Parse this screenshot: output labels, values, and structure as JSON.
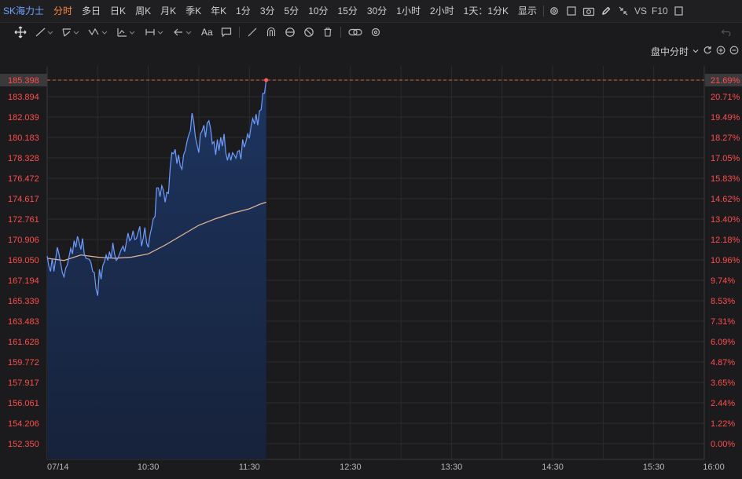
{
  "toolbar": {
    "symbol": "SK海力士",
    "tabs": [
      "分时",
      "多日",
      "日K",
      "周K",
      "月K",
      "季K",
      "年K",
      "1分",
      "3分",
      "5分",
      "10分",
      "15分",
      "30分",
      "1小时",
      "2小时",
      "1天：1分K",
      "显示"
    ],
    "active_tab": "分时",
    "right_labels": {
      "vs": "VS",
      "f10": "F10"
    }
  },
  "drawing_tools": {
    "text_tool": "Aa"
  },
  "mode": {
    "label": "盘中分时"
  },
  "colors": {
    "background": "#1b1b1d",
    "line": "#6f9cff",
    "avg": "#e8b89a",
    "fill_top": "#1d3560",
    "fill_bottom": "#17223a",
    "up_text": "#ff4d4d",
    "grid": "#2c2c2f",
    "ref_line": "#e0603a"
  },
  "chart_data": {
    "type": "line",
    "base_price": 152.35,
    "current_price": 185.398,
    "current_pct": "21.69%",
    "y_labels": [
      "185.398",
      "183.894",
      "182.039",
      "180.183",
      "178.328",
      "176.472",
      "174.617",
      "172.761",
      "170.906",
      "169.050",
      "167.194",
      "165.339",
      "163.483",
      "161.628",
      "159.772",
      "157.917",
      "156.061",
      "154.206",
      "152.350"
    ],
    "pct_labels": [
      "21.69%",
      "20.71%",
      "19.49%",
      "18.27%",
      "17.05%",
      "15.83%",
      "14.62%",
      "13.40%",
      "12.18%",
      "10.96%",
      "9.74%",
      "8.53%",
      "7.31%",
      "6.09%",
      "4.87%",
      "3.65%",
      "2.44%",
      "1.22%",
      "0.00%"
    ],
    "x_labels": [
      "07/14",
      "10:30",
      "11:30",
      "12:30",
      "13:30",
      "14:30",
      "15:30",
      "16:00"
    ],
    "x_label_minutes": [
      0,
      60,
      120,
      180,
      240,
      300,
      360,
      390
    ],
    "price_series": [
      [
        0,
        169.4
      ],
      [
        1,
        168.5
      ],
      [
        2,
        168.0
      ],
      [
        3,
        169.2
      ],
      [
        4,
        168.0
      ],
      [
        6,
        170.2
      ],
      [
        7,
        169.6
      ],
      [
        9,
        167.9
      ],
      [
        10,
        167.5
      ],
      [
        11,
        168.3
      ],
      [
        12,
        168.6
      ],
      [
        14,
        170.1
      ],
      [
        15,
        169.6
      ],
      [
        16,
        170.8
      ],
      [
        17,
        170.2
      ],
      [
        18,
        171.2
      ],
      [
        20,
        170.0
      ],
      [
        21,
        171.0
      ],
      [
        22,
        169.6
      ],
      [
        23,
        169.2
      ],
      [
        25,
        169.1
      ],
      [
        26,
        168.8
      ],
      [
        27,
        168.0
      ],
      [
        28,
        167.9
      ],
      [
        29,
        166.4
      ],
      [
        30,
        165.8
      ],
      [
        31,
        168.2
      ],
      [
        32,
        167.3
      ],
      [
        33,
        168.5
      ],
      [
        34,
        168.9
      ],
      [
        35,
        169.5
      ],
      [
        36,
        169.0
      ],
      [
        37,
        169.8
      ],
      [
        38,
        169.2
      ],
      [
        39,
        170.6
      ],
      [
        40,
        169.6
      ],
      [
        41,
        169.0
      ],
      [
        42,
        169.2
      ],
      [
        44,
        170.0
      ],
      [
        45,
        170.3
      ],
      [
        46,
        169.8
      ],
      [
        48,
        171.5
      ],
      [
        49,
        170.8
      ],
      [
        50,
        171.0
      ],
      [
        51,
        171.7
      ],
      [
        52,
        170.9
      ],
      [
        53,
        171.0
      ],
      [
        55,
        172.1
      ],
      [
        56,
        170.3
      ],
      [
        57,
        171.0
      ],
      [
        58,
        172.0
      ],
      [
        59,
        170.6
      ],
      [
        60,
        170.2
      ],
      [
        61,
        171.3
      ],
      [
        62,
        172.0
      ],
      [
        63,
        172.8
      ],
      [
        64,
        173.0
      ],
      [
        65,
        175.6
      ],
      [
        66,
        175.6
      ],
      [
        67,
        174.8
      ],
      [
        68,
        175.8
      ],
      [
        69,
        175.4
      ],
      [
        70,
        174.3
      ],
      [
        71,
        175.2
      ],
      [
        72,
        175.1
      ],
      [
        73,
        177.4
      ],
      [
        74,
        178.8
      ],
      [
        75,
        178.7
      ],
      [
        76,
        179.1
      ],
      [
        77,
        177.8
      ],
      [
        78,
        178.6
      ],
      [
        79,
        177.6
      ],
      [
        80,
        177.3
      ],
      [
        81,
        178.6
      ],
      [
        82,
        179.0
      ],
      [
        83,
        179.8
      ],
      [
        84,
        180.4
      ],
      [
        85,
        180.8
      ],
      [
        86,
        182.4
      ],
      [
        87,
        181.6
      ],
      [
        88,
        180.2
      ],
      [
        89,
        179.5
      ],
      [
        90,
        178.8
      ],
      [
        91,
        180.5
      ],
      [
        92,
        180.8
      ],
      [
        93,
        181.3
      ],
      [
        94,
        180.2
      ],
      [
        95,
        181.5
      ],
      [
        96,
        181.7
      ],
      [
        97,
        181.0
      ],
      [
        98,
        179.6
      ],
      [
        99,
        179.8
      ],
      [
        100,
        178.6
      ],
      [
        101,
        180.0
      ],
      [
        102,
        179.0
      ],
      [
        103,
        180.2
      ],
      [
        104,
        179.4
      ],
      [
        105,
        180.5
      ],
      [
        106,
        178.8
      ],
      [
        107,
        178.1
      ],
      [
        108,
        178.8
      ],
      [
        109,
        178.1
      ],
      [
        110,
        178.8
      ],
      [
        111,
        178.6
      ],
      [
        112,
        178.3
      ],
      [
        113,
        178.9
      ],
      [
        114,
        179.0
      ],
      [
        115,
        178.2
      ],
      [
        116,
        180.0
      ],
      [
        117,
        179.3
      ],
      [
        118,
        179.8
      ],
      [
        119,
        180.5
      ],
      [
        120,
        180.1
      ],
      [
        121,
        181.2
      ],
      [
        122,
        181.9
      ],
      [
        123,
        181.4
      ],
      [
        124,
        182.3
      ],
      [
        125,
        181.3
      ],
      [
        126,
        182.6
      ],
      [
        127,
        182.7
      ],
      [
        128,
        184.2
      ],
      [
        129,
        184.2
      ],
      [
        130,
        185.398
      ]
    ],
    "avg_series": [
      [
        0,
        169.2
      ],
      [
        10,
        169.0
      ],
      [
        20,
        169.5
      ],
      [
        30,
        169.3
      ],
      [
        40,
        169.2
      ],
      [
        50,
        169.3
      ],
      [
        60,
        169.6
      ],
      [
        70,
        170.4
      ],
      [
        80,
        171.3
      ],
      [
        90,
        172.2
      ],
      [
        100,
        172.8
      ],
      [
        110,
        173.3
      ],
      [
        120,
        173.7
      ],
      [
        126,
        174.1
      ],
      [
        130,
        174.3
      ]
    ]
  }
}
